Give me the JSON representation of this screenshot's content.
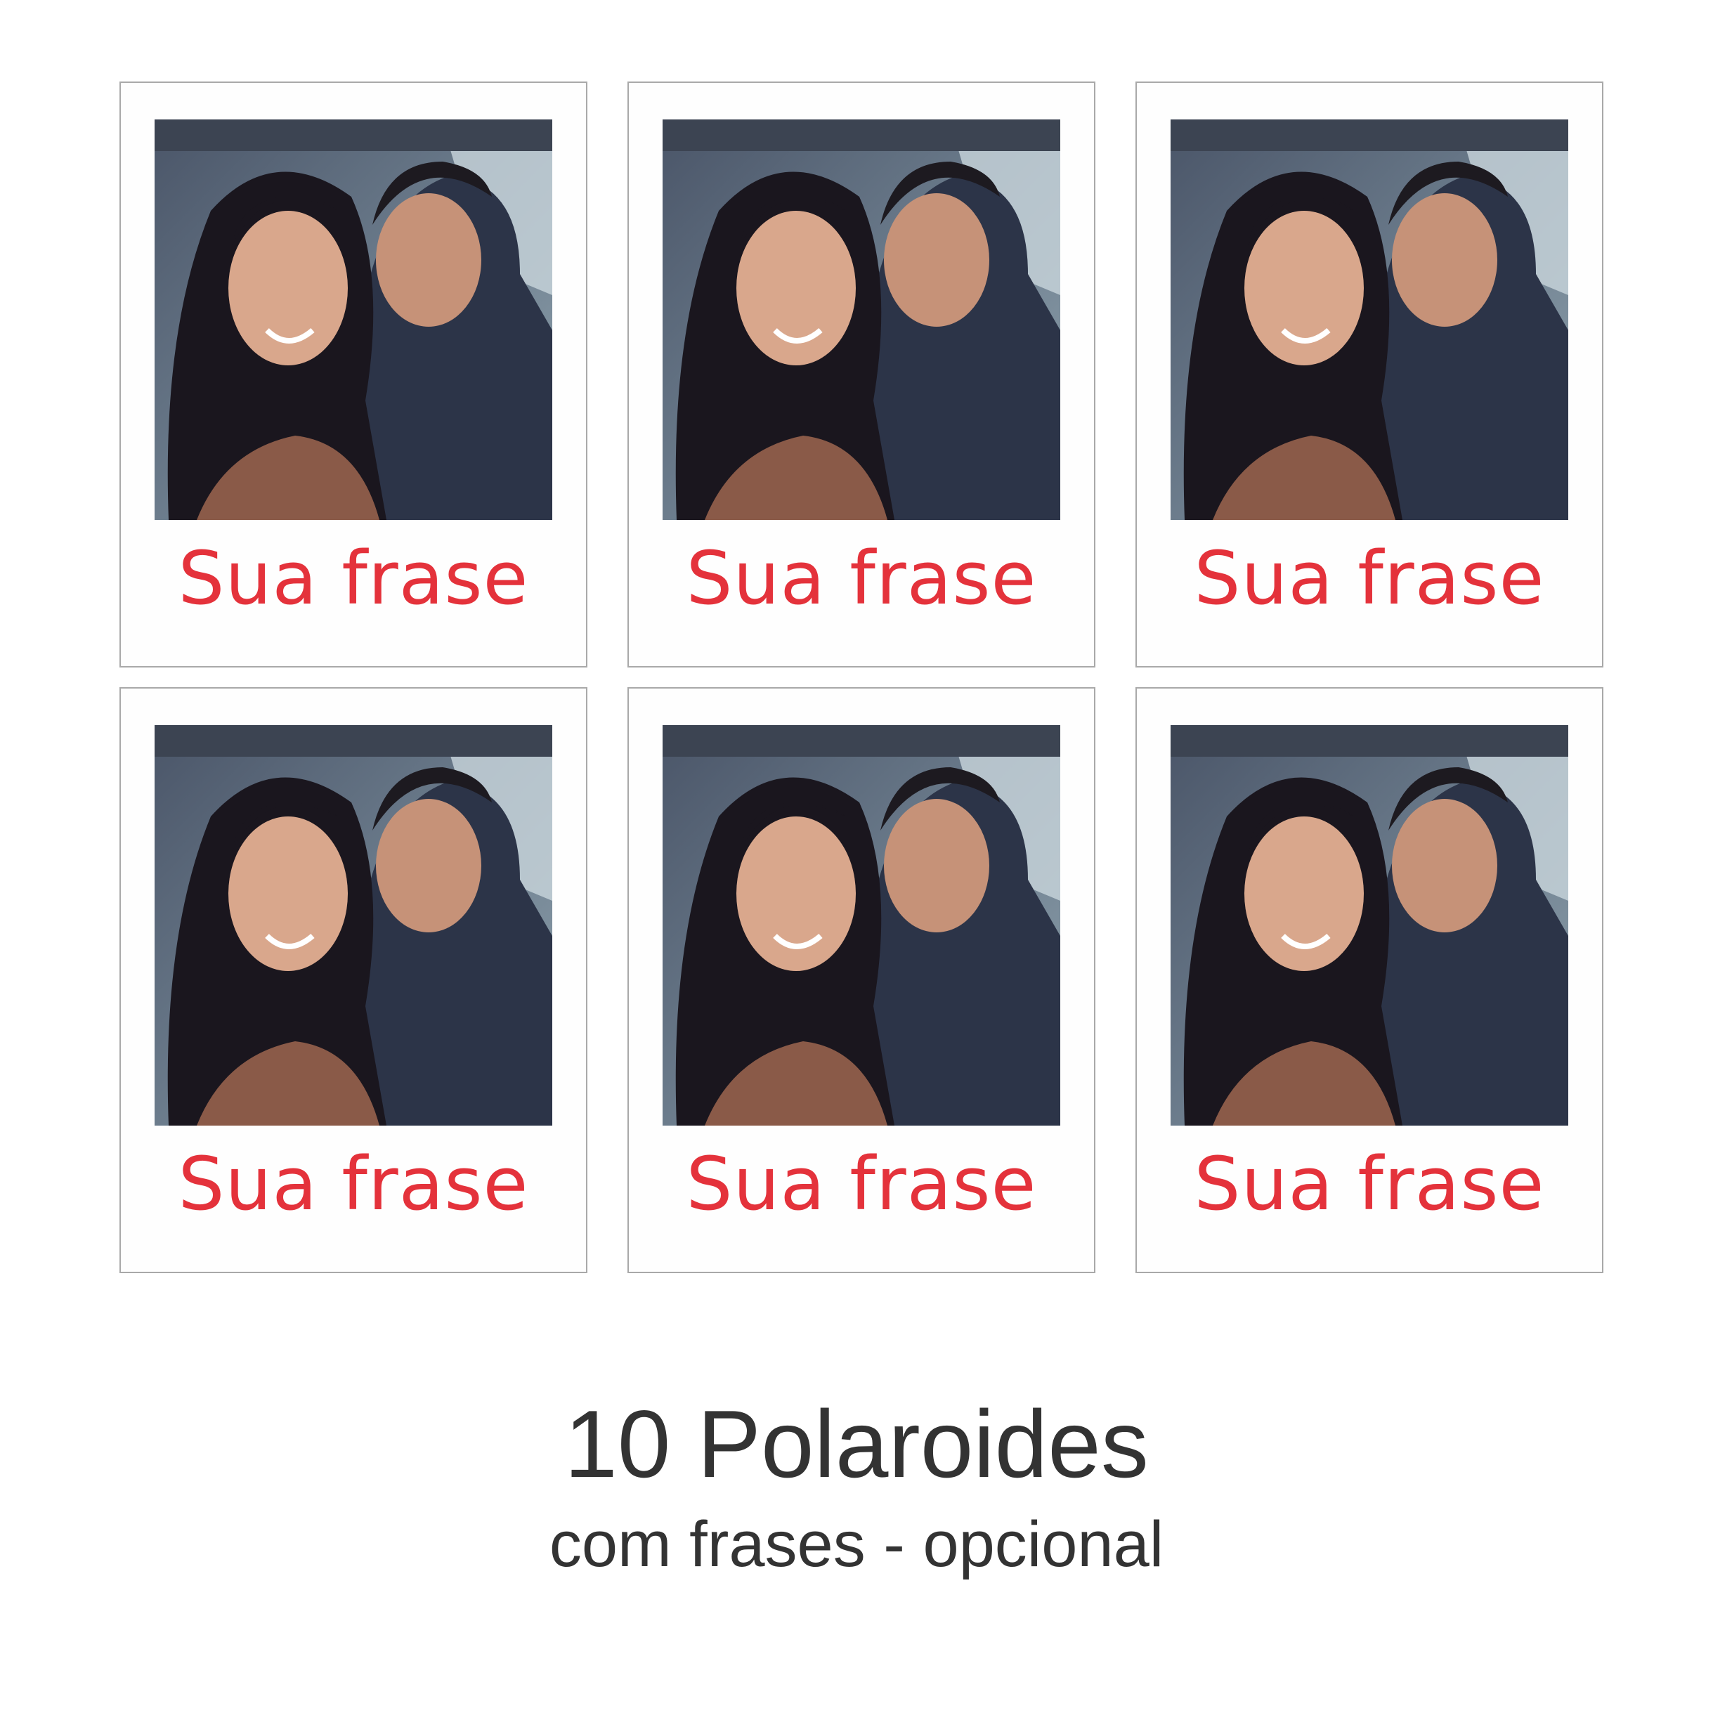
{
  "polaroids": [
    {
      "caption": "Sua frase"
    },
    {
      "caption": "Sua frase"
    },
    {
      "caption": "Sua frase"
    },
    {
      "caption": "Sua frase"
    },
    {
      "caption": "Sua frase"
    },
    {
      "caption": "Sua frase"
    }
  ],
  "footer": {
    "title": "10 Polaroides",
    "subtitle": "com frases - opcional"
  },
  "colors": {
    "caption": "#e4323b",
    "border": "#a9a9a9",
    "footer_text": "#333333"
  }
}
